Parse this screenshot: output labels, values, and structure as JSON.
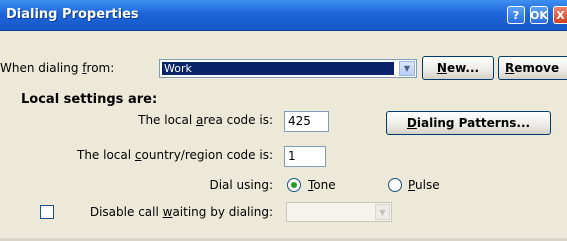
{
  "window": {
    "title": "Dialing Properties",
    "help_label": "?",
    "ok_label": "OK",
    "close_label": "X"
  },
  "dialing_from": {
    "label_prefix": "When dialing ",
    "label_accel": "f",
    "label_suffix": "rom:",
    "value": "Work",
    "new_prefix": "",
    "new_accel": "N",
    "new_suffix": "ew...",
    "remove_prefix": "",
    "remove_accel": "R",
    "remove_suffix": "emove"
  },
  "local": {
    "heading": "Local settings are:",
    "area_label_prefix": "The local ",
    "area_label_accel": "a",
    "area_label_suffix": "rea code is:",
    "area_value": "425",
    "patterns_prefix": "",
    "patterns_accel": "D",
    "patterns_suffix": "ialing Patterns...",
    "country_label_prefix": "The local ",
    "country_label_accel": "c",
    "country_label_suffix": "ountry/region code is:",
    "country_value": "1",
    "dial_using_label": "Dial using:",
    "tone_accel": "T",
    "tone_suffix": "one",
    "pulse_accel": "P",
    "pulse_suffix": "ulse",
    "tone_selected": true,
    "disable_prefix": "Disable call ",
    "disable_accel": "w",
    "disable_suffix": "aiting by dialing:",
    "disable_checked": false
  }
}
